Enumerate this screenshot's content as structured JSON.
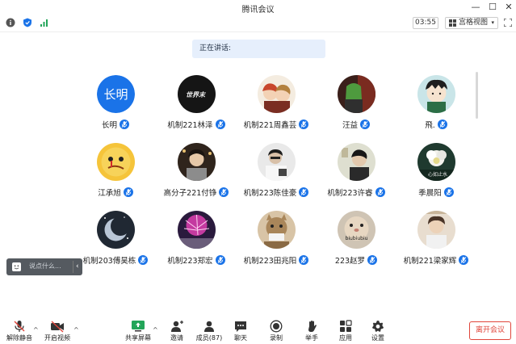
{
  "window": {
    "title": "腾讯会议"
  },
  "topbar": {
    "timer": "03:55",
    "view_label": "宫格视图"
  },
  "speaking": {
    "label": "正在讲话:"
  },
  "participants": [
    {
      "name": "长明",
      "avatar_text": "长明"
    },
    {
      "name": "机制221林泽",
      "avatar_text": "世界末"
    },
    {
      "name": "机制221周鑫芸"
    },
    {
      "name": "汪益"
    },
    {
      "name": "飛."
    },
    {
      "name": "江承旭"
    },
    {
      "name": "高分子221付铮"
    },
    {
      "name": "机制223陈佳豪"
    },
    {
      "name": "机制223许睿"
    },
    {
      "name": "季晨阳",
      "avatar_text": "心如止水"
    },
    {
      "name": "机制203傅昊栋"
    },
    {
      "name": "机制223郑宏"
    },
    {
      "name": "机制223田兆阳"
    },
    {
      "name": "223赵罗",
      "avatar_text": "biubiubiu"
    },
    {
      "name": "机制221梁家辉"
    }
  ],
  "reaction": {
    "placeholder": "说点什么...",
    "chevron": "‹"
  },
  "toolbar": {
    "unmute": "解除静音",
    "video": "开启视频",
    "share": "共享屏幕",
    "invite": "邀请",
    "members": "成员(87)",
    "chat": "聊天",
    "record": "录制",
    "raise": "举手",
    "apps": "应用",
    "settings": "设置",
    "leave": "离开会议"
  },
  "colors": {
    "accent": "#1a73e8",
    "leave": "#e0463c",
    "speaking_bg": "#e6effc",
    "share_green": "#22a559"
  }
}
